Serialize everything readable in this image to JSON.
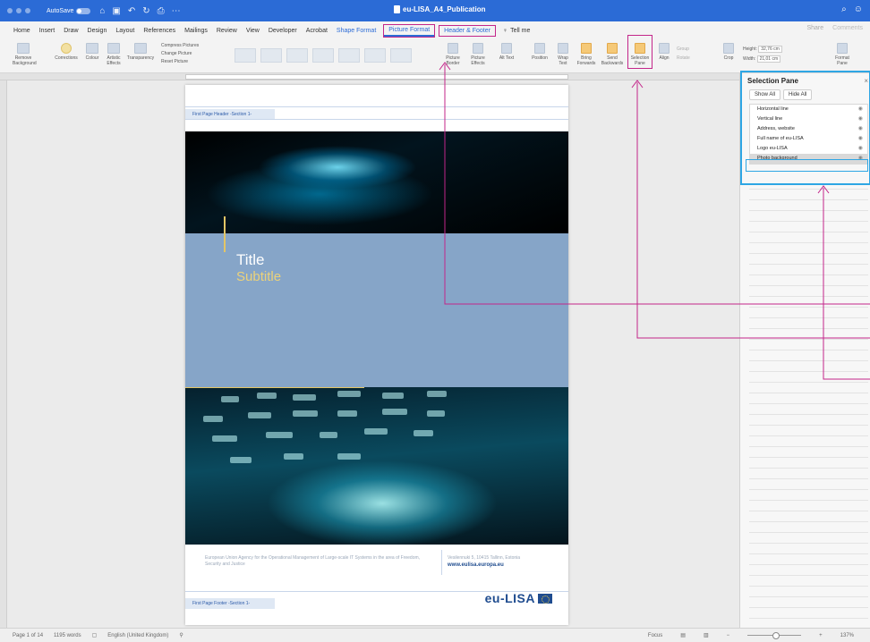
{
  "titlebar": {
    "autosave_label": "AutoSave",
    "autosave_state": "OFF",
    "document_title": "eu-LISA_A4_Publication"
  },
  "tabs": [
    {
      "label": "Home"
    },
    {
      "label": "Insert"
    },
    {
      "label": "Draw"
    },
    {
      "label": "Design"
    },
    {
      "label": "Layout"
    },
    {
      "label": "References"
    },
    {
      "label": "Mailings"
    },
    {
      "label": "Review"
    },
    {
      "label": "View"
    },
    {
      "label": "Developer"
    },
    {
      "label": "Acrobat"
    },
    {
      "label": "Shape Format"
    },
    {
      "label": "Picture Format"
    },
    {
      "label": "Header & Footer"
    }
  ],
  "tell_me": "Tell me",
  "share_label": "Share",
  "comments_label": "Comments",
  "ribbon": {
    "remove_background": "Remove Background",
    "corrections": "Corrections",
    "colour": "Colour",
    "artistic_effects": "Artistic Effects",
    "transparency": "Transparency",
    "compress_pictures": "Compress Pictures",
    "change_picture": "Change Picture",
    "reset_picture": "Reset Picture",
    "picture_border": "Picture Border",
    "picture_effects": "Picture Effects",
    "alt_text": "Alt Text",
    "position": "Position",
    "wrap_text": "Wrap Text",
    "bring_forwards": "Bring Forwards",
    "send_backwards": "Send Backwards",
    "selection_pane": "Selection Pane",
    "align": "Align",
    "group": "Group",
    "rotate": "Rotate",
    "crop": "Crop",
    "height_label": "Height:",
    "height_value": "32,76 cm",
    "width_label": "Width:",
    "width_value": "21,01 cm",
    "format_pane": "Format Pane"
  },
  "document": {
    "header_label": "First Page Header -Section 1-",
    "title": "Title",
    "subtitle": "Subtitle",
    "agency_text": "European Union Agency for the Operational Management of Large-scale IT Systems in the area of Freedom, Security and Justice",
    "address": "Vesilennuki 5, 10415 Tallinn, Estonia",
    "website": "www.eulisa.europa.eu",
    "footer_label": "First Page Footer -Section 1-",
    "logo_text": "eu-LISA"
  },
  "selection_pane": {
    "title": "Selection Pane",
    "show_all": "Show All",
    "hide_all": "Hide All",
    "items": [
      {
        "label": "Horizontal line"
      },
      {
        "label": "Vertical line"
      },
      {
        "label": "Address, website"
      },
      {
        "label": "Full name of eu-LISA"
      },
      {
        "label": "Logo eu-LISA"
      },
      {
        "label": "Photo background"
      }
    ]
  },
  "statusbar": {
    "page": "Page 1 of 14",
    "words": "1195 words",
    "language": "English (United Kingdom)",
    "focus": "Focus",
    "zoom": "137%"
  },
  "colors": {
    "accent": "#2b6bd6",
    "annotation_magenta": "#c3268a",
    "annotation_blue": "#2ea6e4",
    "title_band": "#86a5c8",
    "subtitle_gold": "#ecd27a"
  }
}
